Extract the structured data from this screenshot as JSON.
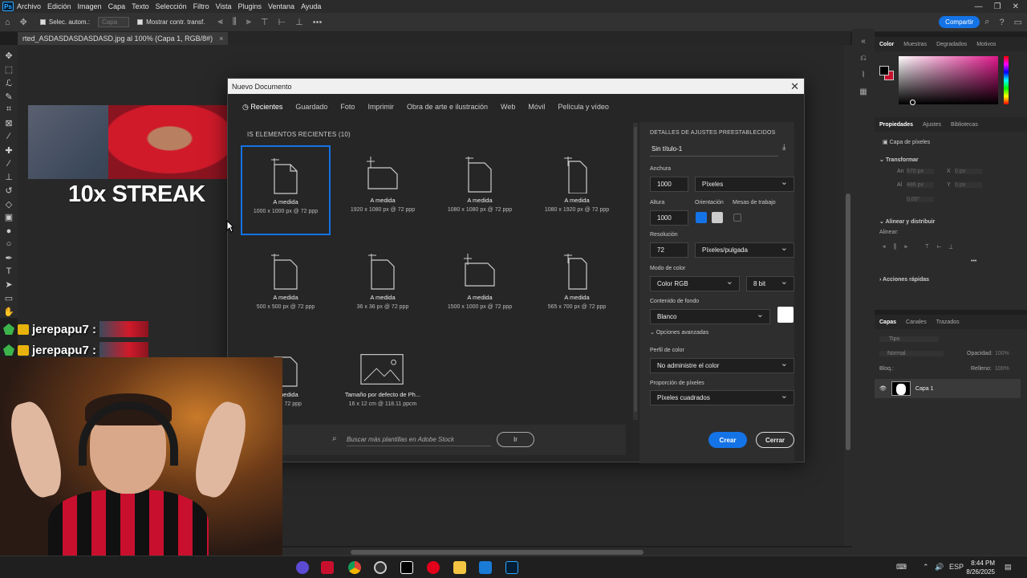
{
  "menu": {
    "items": [
      "Archivo",
      "Edición",
      "Imagen",
      "Capa",
      "Texto",
      "Selección",
      "Filtro",
      "Vista",
      "Plugins",
      "Ventana",
      "Ayuda"
    ]
  },
  "options": {
    "auto_select": "Selec. autom.:",
    "layer": "Capa",
    "show_transform": "Mostrar contr. transf.",
    "share": "Compartir"
  },
  "doc_tab": {
    "title": "rted_ASDASDASDASDASD.jpg al 100% (Capa 1, RGB/8#)"
  },
  "overlay": {
    "streak_text": "10x STREAK",
    "chat": [
      {
        "user": "jerepapu7 :"
      },
      {
        "user": "jerepapu7 :"
      }
    ]
  },
  "dialog": {
    "title": "Nuevo Documento",
    "tabs": [
      "Recientes",
      "Guardado",
      "Foto",
      "Imprimir",
      "Obra de arte e ilustración",
      "Web",
      "Móvil",
      "Película y vídeo"
    ],
    "recent_label": "IS ELEMENTOS RECIENTES",
    "recent_count": "(10)",
    "presets": [
      {
        "name": "A medida",
        "dims": "1000 x 1000 px @ 72 ppp"
      },
      {
        "name": "A medida",
        "dims": "1920 x 1080 px @ 72 ppp"
      },
      {
        "name": "A medida",
        "dims": "1080 x 1080 px @ 72 ppp"
      },
      {
        "name": "A medida",
        "dims": "1080 x 1920 px @ 72 ppp"
      },
      {
        "name": "A medida",
        "dims": "500 x 500 px @ 72 ppp"
      },
      {
        "name": "A medida",
        "dims": "36 x 36 px @ 72 ppp"
      },
      {
        "name": "A medida",
        "dims": "1500 x 1000 px @ 72 ppp"
      },
      {
        "name": "A medida",
        "dims": "565 x 700 px @ 72 ppp"
      },
      {
        "name": "A medida",
        "dims": "px @ 72 ppp"
      },
      {
        "name": "Tamaño por defecto de Ph...",
        "dims": "16 x 12 cm @ 118.11 ppcm"
      }
    ],
    "search_placeholder": "Buscar más plantillas en Adobe Stock",
    "search_button": "Ir",
    "settings": {
      "header": "DETALLES DE AJUSTES PREESTABLECIDOS",
      "doc_name": "Sin título-1",
      "width_label": "Anchura",
      "width": "1000",
      "width_unit": "Píxeles",
      "height_label": "Altura",
      "height": "1000",
      "orientation_label": "Orientación",
      "artboards_label": "Mesas de trabajo",
      "resolution_label": "Resolución",
      "resolution": "72",
      "resolution_unit": "Píxeles/pulgada",
      "color_mode_label": "Modo de color",
      "color_mode": "Color RGB",
      "bit_depth": "8 bit",
      "background_label": "Contenido de fondo",
      "background": "Blanco",
      "advanced": "Opciones avanzadas",
      "profile_label": "Perfil de color",
      "profile": "No administre el color",
      "pixel_ratio_label": "Proporción de píxeles",
      "pixel_ratio": "Píxeles cuadrados"
    },
    "create": "Crear",
    "close": "Cerrar"
  },
  "panels": {
    "color_tabs": [
      "Color",
      "Muestras",
      "Degradados",
      "Motivos"
    ],
    "props_tabs": [
      "Propiedades",
      "Ajustes",
      "Bibliotecas"
    ],
    "pixel_layer": "Capa de píxeles",
    "transform": "Transformar",
    "an": "An",
    "al": "Al",
    "x": "X",
    "y": "Y",
    "an_val": "670 px",
    "al_val": "486 px",
    "x_val": "0 px",
    "y_val": "0 px",
    "angle_val": "0,00°",
    "align": "Alinear y distribuir",
    "align_sub": "Alinear:",
    "quick": "Acciones rápidas",
    "layers_tabs": [
      "Capas",
      "Canales",
      "Trazados"
    ],
    "search_kind": "Tipo",
    "blend": "Normal",
    "opacity_label": "Opacidad:",
    "opacity": "100%",
    "lock_label": "Bloq.:",
    "fill_label": "Relleno:",
    "fill": "100%",
    "layer_name": "Capa 1"
  },
  "taskbar": {
    "lang": "ESP",
    "time": "8:44 PM",
    "date": "8/26/2025"
  }
}
